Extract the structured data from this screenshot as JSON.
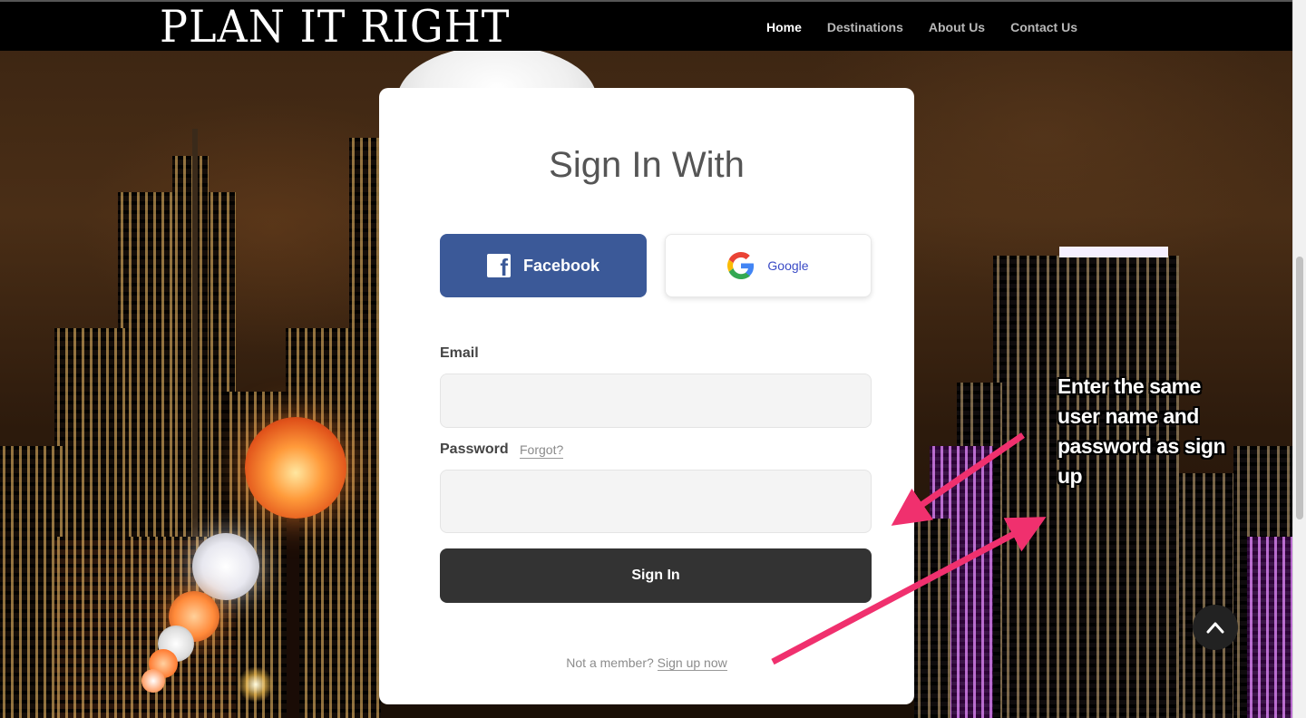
{
  "header": {
    "logo": "PLAN IT RIGHT",
    "nav": [
      {
        "label": "Home",
        "active": true
      },
      {
        "label": "Destinations",
        "active": false
      },
      {
        "label": "About Us",
        "active": false
      },
      {
        "label": "Contact Us",
        "active": false
      }
    ]
  },
  "signin": {
    "title": "Sign In With",
    "facebook_label": "Facebook",
    "google_label": "Google",
    "email_label": "Email",
    "email_value": "",
    "password_label": "Password",
    "password_value": "",
    "forgot_label": "Forgot?",
    "submit_label": "Sign In",
    "member_text": "Not a member?",
    "signup_label": "Sign up now"
  },
  "annotation": {
    "text": "Enter the same user name and password as sign up",
    "color": "#f0306e"
  },
  "icons": {
    "facebook": "facebook-icon",
    "google": "google-icon",
    "scroll_top": "chevron-up-icon"
  },
  "colors": {
    "facebook": "#3b5998",
    "button_dark": "#333333",
    "header_bg": "#000000"
  }
}
